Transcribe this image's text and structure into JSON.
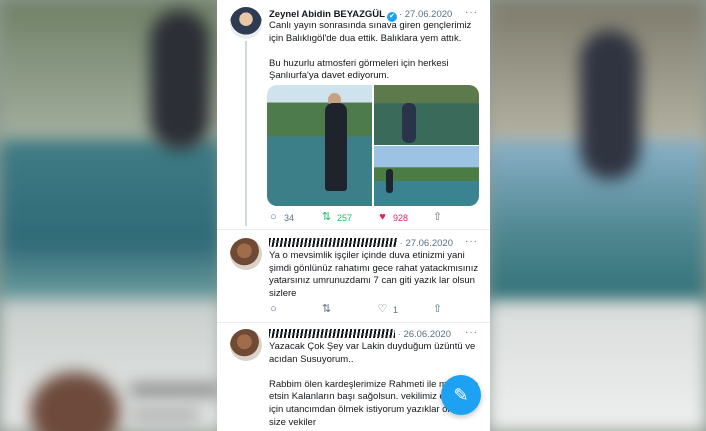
{
  "tweets": [
    {
      "author": "Zeynel Abidin BEYAZGÜL",
      "date": "27.06.2020",
      "more": "···",
      "text": "Canlı yayın sonrasında sınava giren gençlerimiz için Balıklıgöl'de dua ettik. Balıklara yem attık.\n\nBu huzurlu atmosferi görmeleri için herkesi Şanlıurfa'ya davet ediyorum.",
      "reply_count": "34",
      "retweet_count": "257",
      "like_count": "928"
    },
    {
      "date": "· 27.06.2020",
      "more": "···",
      "text": "Ya o mevsimlik işçiler içinde duva etinizmi yani şimdi gönlünüz rahatımı gece rahat yatackmısınız yatarsınız umrunuzdamı 7 can giti yazık lar olsun sizlere",
      "like_count": "1"
    },
    {
      "date": "· 26.06.2020",
      "more": "···",
      "text": "Yazacak Çok Şey var Lakin duyduğum üzüntü ve acıdan Susuyorum..\n\nRabbim ölen kardeşlerimize Rahmeti ile muamele etsin Kalanların başı sağolsun. vekilimiz olduğu için utancımdan ölmek istiyorum yazıklar olsun size vekiler"
    }
  ],
  "icons": {
    "verified": "✔",
    "reply": "○",
    "retweet": "⇅",
    "like": "♥",
    "like_outline": "♡",
    "share": "⇧",
    "compose": "✎"
  },
  "colors": {
    "accent": "#1da1f2",
    "retweet": "#17bf63",
    "like": "#e0245e"
  }
}
